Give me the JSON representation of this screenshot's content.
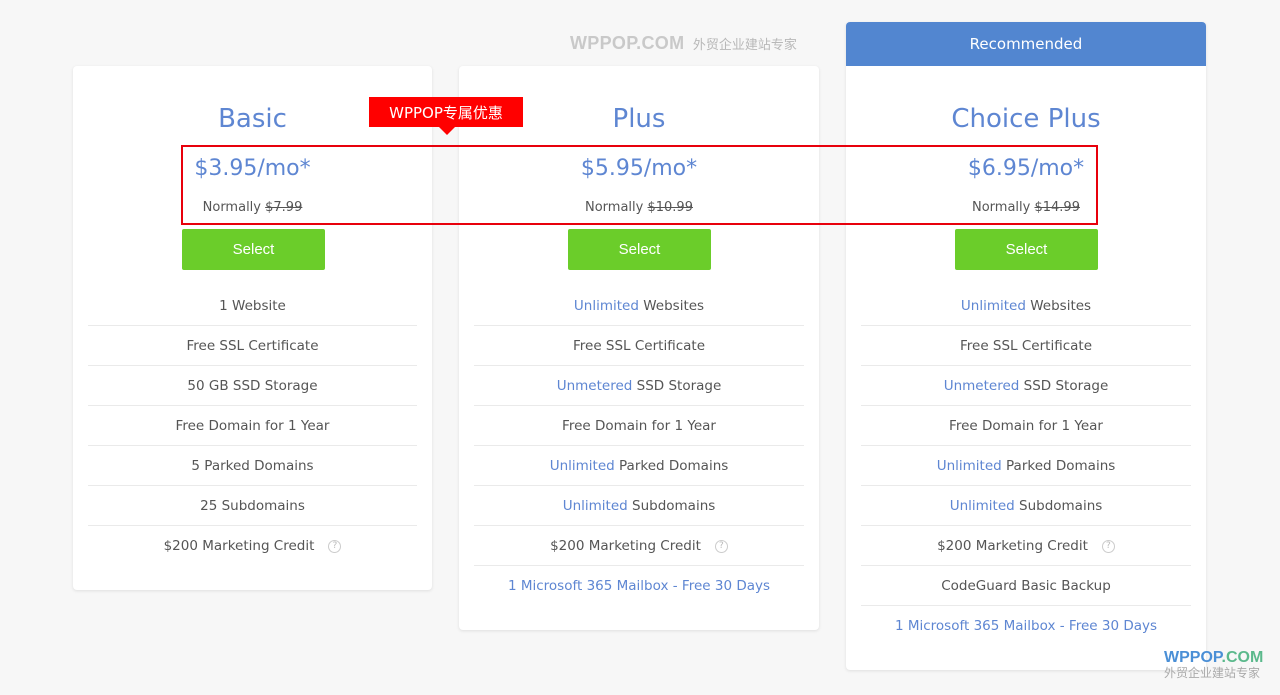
{
  "watermark_top": {
    "brand": "WPPOP.COM",
    "tagline": "外贸企业建站专家"
  },
  "promo_tag": "WPPOP专属优惠",
  "colors": {
    "accent_blue": "#5e86d2",
    "select_green": "#6bcd2a",
    "highlight_red": "#e8000c",
    "recommended_bg": "#5286d0"
  },
  "plans": [
    {
      "name": "Basic",
      "price": "$3.95/mo*",
      "normally_label": "Normally",
      "normal_price": "$7.99",
      "select_label": "Select",
      "features": [
        {
          "hl": "",
          "text": "1 Website"
        },
        {
          "hl": "",
          "text": "Free SSL Certificate"
        },
        {
          "hl": "",
          "text": "50 GB SSD Storage"
        },
        {
          "hl": "",
          "text": "Free Domain for 1 Year"
        },
        {
          "hl": "",
          "text": "5 Parked Domains"
        },
        {
          "hl": "",
          "text": "25 Subdomains"
        },
        {
          "hl": "",
          "text": "$200 Marketing Credit",
          "help": "?"
        }
      ]
    },
    {
      "name": "Plus",
      "price": "$5.95/mo*",
      "normally_label": "Normally",
      "normal_price": "$10.99",
      "select_label": "Select",
      "features": [
        {
          "hl": "Unlimited",
          "text": " Websites"
        },
        {
          "hl": "",
          "text": "Free SSL Certificate"
        },
        {
          "hl": "Unmetered",
          "text": " SSD Storage"
        },
        {
          "hl": "",
          "text": "Free Domain for 1 Year"
        },
        {
          "hl": "Unlimited",
          "text": " Parked Domains"
        },
        {
          "hl": "Unlimited",
          "text": " Subdomains"
        },
        {
          "hl": "",
          "text": "$200 Marketing Credit",
          "help": "?"
        },
        {
          "hl": "",
          "text": "1 Microsoft 365 Mailbox - Free 30 Days",
          "link": true
        }
      ]
    },
    {
      "name": "Choice Plus",
      "recommended_label": "Recommended",
      "price": "$6.95/mo*",
      "normally_label": "Normally",
      "normal_price": "$14.99",
      "select_label": "Select",
      "features": [
        {
          "hl": "Unlimited",
          "text": " Websites"
        },
        {
          "hl": "",
          "text": "Free SSL Certificate"
        },
        {
          "hl": "Unmetered",
          "text": " SSD Storage"
        },
        {
          "hl": "",
          "text": "Free Domain for 1 Year"
        },
        {
          "hl": "Unlimited",
          "text": " Parked Domains"
        },
        {
          "hl": "Unlimited",
          "text": " Subdomains"
        },
        {
          "hl": "",
          "text": "$200 Marketing Credit",
          "help": "?"
        },
        {
          "hl": "",
          "text": "CodeGuard Basic Backup"
        },
        {
          "hl": "",
          "text": "1 Microsoft 365 Mailbox - Free 30 Days",
          "link": true
        }
      ]
    }
  ],
  "watermark_bottom": {
    "brand_wp": "WPPOP",
    "brand_com": ".COM",
    "tagline": "外贸企业建站专家"
  }
}
